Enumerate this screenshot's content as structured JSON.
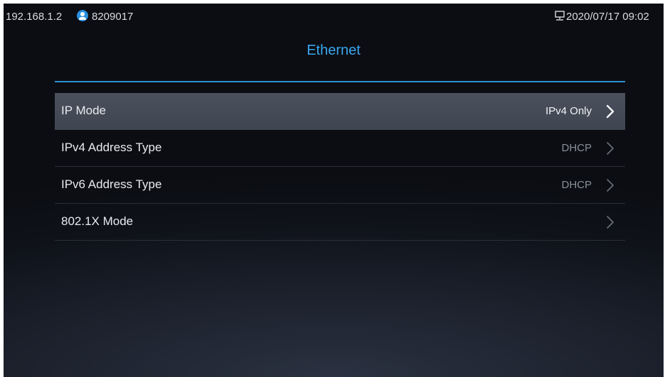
{
  "status_bar": {
    "ip_address": "192.168.1.2",
    "account_icon": "account-icon",
    "account_number": "8209017",
    "network_icon": "network-icon",
    "datetime": "2020/07/17 09:02"
  },
  "page": {
    "title": "Ethernet"
  },
  "menu": {
    "items": [
      {
        "label": "IP Mode",
        "value": "IPv4 Only",
        "icon": "chevron-right-icon",
        "selected": true
      },
      {
        "label": "IPv4 Address Type",
        "value": "DHCP",
        "icon": "chevron-right-icon",
        "selected": false
      },
      {
        "label": "IPv6 Address Type",
        "value": "DHCP",
        "icon": "chevron-right-icon",
        "selected": false
      },
      {
        "label": "802.1X Mode",
        "value": "",
        "icon": "chevron-right-icon",
        "selected": false
      }
    ]
  },
  "colors": {
    "accent": "#3aa6f0",
    "selected_row": "#454c57",
    "background": "#0f1219",
    "value_text": "#8a9099"
  }
}
